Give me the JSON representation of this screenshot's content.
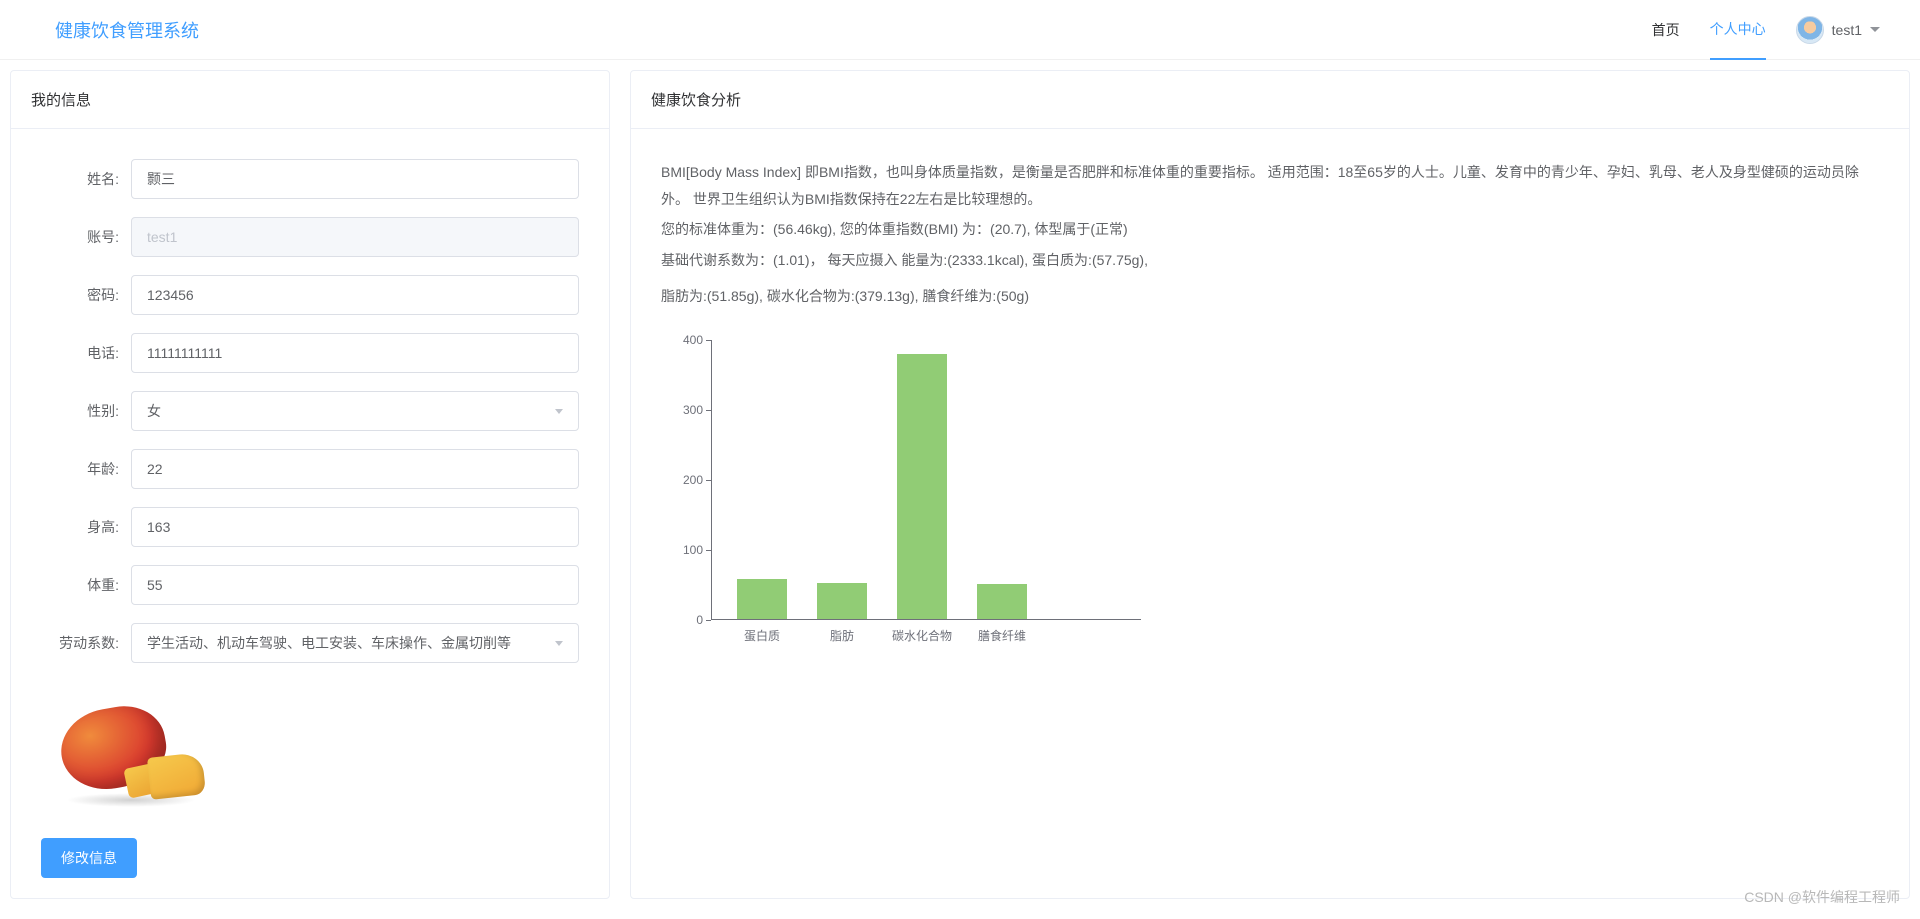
{
  "header": {
    "brand": "健康饮食管理系统",
    "nav": [
      {
        "label": "首页",
        "active": false
      },
      {
        "label": "个人中心",
        "active": true
      }
    ],
    "username": "test1"
  },
  "left": {
    "title": "我的信息",
    "fields": {
      "name_label": "姓名:",
      "name_value": "颢三",
      "account_label": "账号:",
      "account_value": "test1",
      "password_label": "密码:",
      "password_value": "123456",
      "phone_label": "电话:",
      "phone_value": "11111111111",
      "gender_label": "性别:",
      "gender_value": "女",
      "age_label": "年龄:",
      "age_value": "22",
      "height_label": "身高:",
      "height_value": "163",
      "weight_label": "体重:",
      "weight_value": "55",
      "labor_label": "劳动系数:",
      "labor_value": "学生活动、机动车驾驶、电工安装、车床操作、金属切削等"
    },
    "submit": "修改信息"
  },
  "right": {
    "title": "健康饮食分析",
    "paragraphs": [
      "BMI[Body Mass Index] 即BMI指数，也叫身体质量指数，是衡量是否肥胖和标准体重的重要指标。 适用范围：18至65岁的人士。儿童、发育中的青少年、孕妇、乳母、老人及身型健硕的运动员除外。 世界卫生组织认为BMI指数保持在22左右是比较理想的。",
      "您的标准体重为：(56.46kg), 您的体重指数(BMI)  为：(20.7), 体型属于(正常)",
      "基础代谢系数为：(1.01)，  每天应摄入 能量为:(2333.1kcal), 蛋白质为:(57.75g),",
      "脂肪为:(51.85g), 碳水化合物为:(379.13g), 膳食纤维为:(50g)"
    ]
  },
  "chart_data": {
    "type": "bar",
    "categories": [
      "蛋白质",
      "脂肪",
      "碳水化合物",
      "膳食纤维"
    ],
    "values": [
      57.75,
      51.85,
      379.13,
      50
    ],
    "ylim": [
      0,
      400
    ],
    "yticks": [
      0,
      100,
      200,
      300,
      400
    ],
    "color": "#91cc75",
    "title": "",
    "xlabel": "",
    "ylabel": ""
  },
  "watermark": "CSDN @软件编程工程师"
}
